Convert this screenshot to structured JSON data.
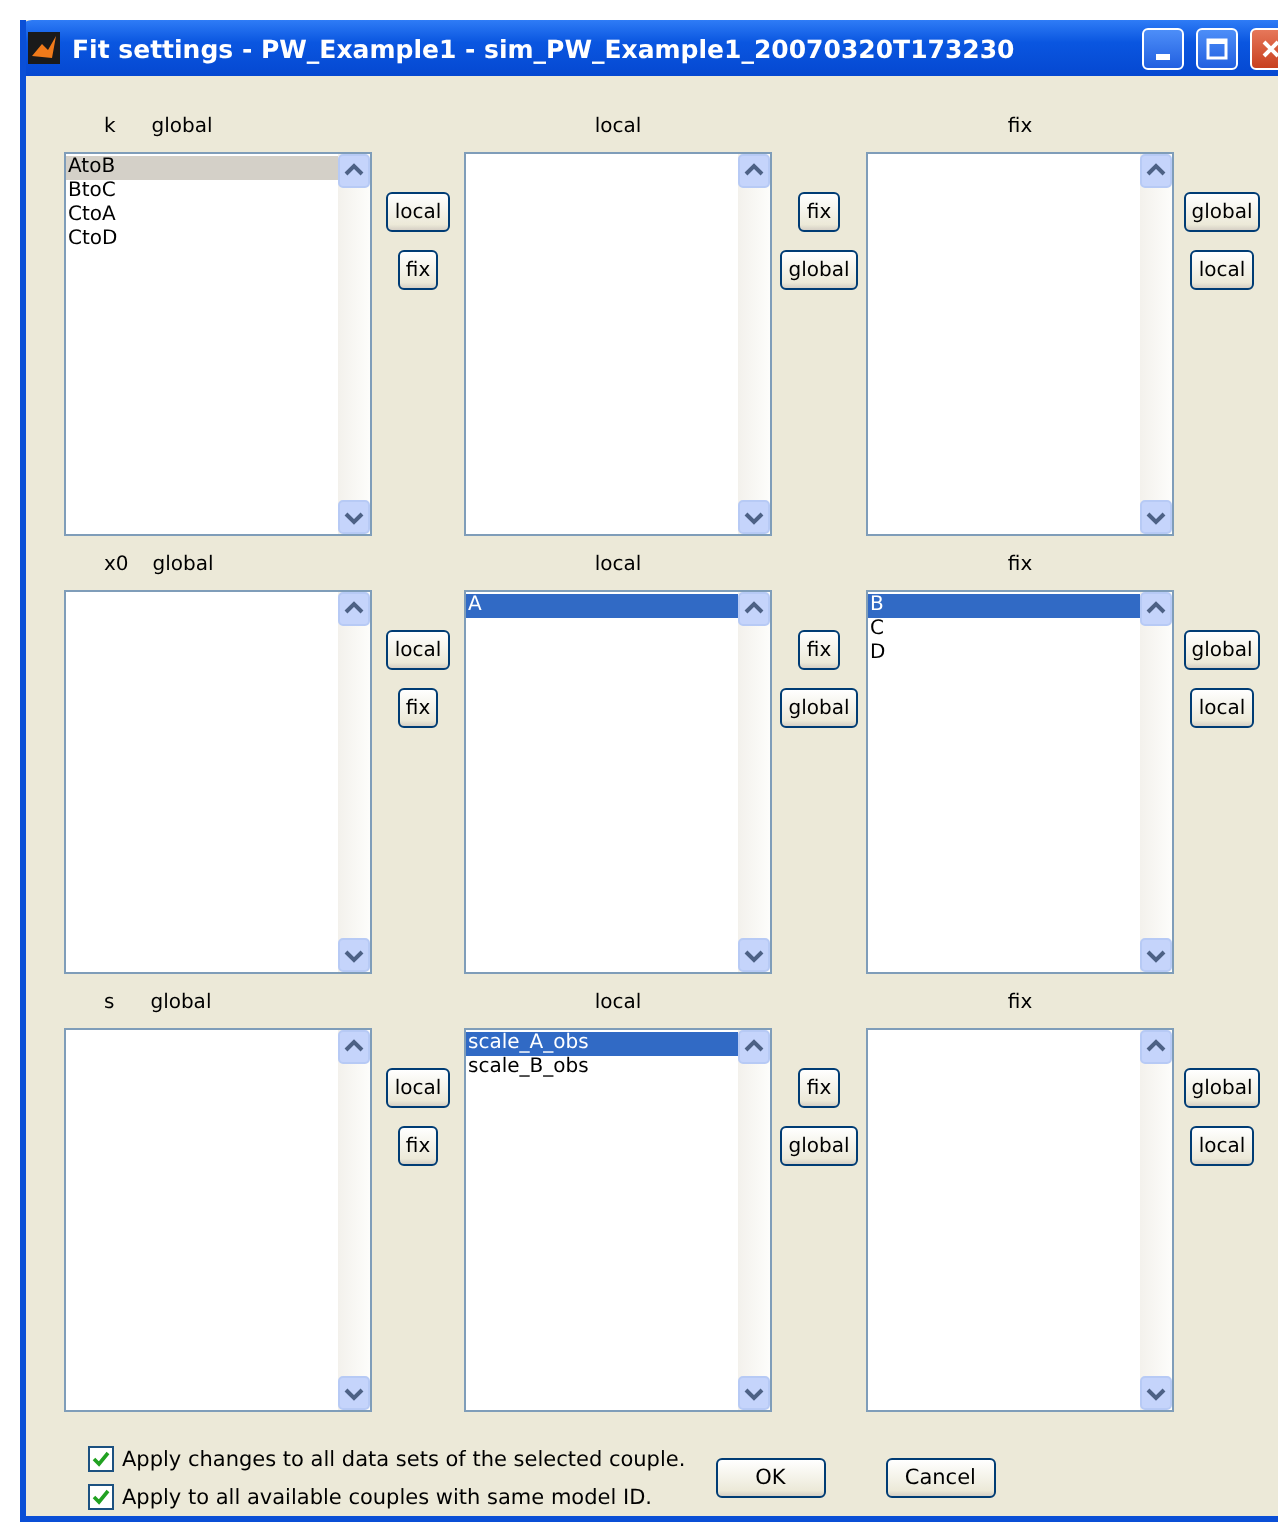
{
  "window": {
    "title": "Fit settings - PW_Example1 - sim_PW_Example1_20070320T173230"
  },
  "groups": [
    {
      "name": "k",
      "columns": [
        {
          "label": "global",
          "focused": false,
          "items": [
            {
              "text": "AtoB",
              "selected": true
            },
            {
              "text": "BtoC",
              "selected": false
            },
            {
              "text": "CtoA",
              "selected": false
            },
            {
              "text": "CtoD",
              "selected": false
            }
          ],
          "buttons": [
            "local",
            "fix"
          ]
        },
        {
          "label": "local",
          "buttons": [
            "fix",
            "global"
          ]
        },
        {
          "label": "fix",
          "buttons": [
            "global",
            "local"
          ]
        }
      ]
    },
    {
      "name": "x0",
      "columns": [
        {
          "label": "global",
          "buttons": [
            "local",
            "fix"
          ]
        },
        {
          "label": "local",
          "focused": true,
          "items": [
            {
              "text": "A",
              "selected": true
            }
          ],
          "buttons": [
            "fix",
            "global"
          ]
        },
        {
          "label": "fix",
          "focused": true,
          "items": [
            {
              "text": "B",
              "selected": true
            },
            {
              "text": "C",
              "selected": false
            },
            {
              "text": "D",
              "selected": false
            }
          ],
          "buttons": [
            "global",
            "local"
          ]
        }
      ]
    },
    {
      "name": "s",
      "columns": [
        {
          "label": "global",
          "buttons": [
            "local",
            "fix"
          ]
        },
        {
          "label": "local",
          "focused": true,
          "items": [
            {
              "text": "scale_A_obs",
              "selected": true
            },
            {
              "text": "scale_B_obs",
              "selected": false
            }
          ],
          "buttons": [
            "fix",
            "global"
          ]
        },
        {
          "label": "fix",
          "buttons": [
            "global",
            "local"
          ]
        }
      ]
    }
  ],
  "options": [
    {
      "label": "Apply changes to all data sets of the selected couple.",
      "checked": true
    },
    {
      "label": "Apply to all available couples with same model ID.",
      "checked": true
    }
  ],
  "buttons": [
    "OK",
    "Cancel"
  ]
}
